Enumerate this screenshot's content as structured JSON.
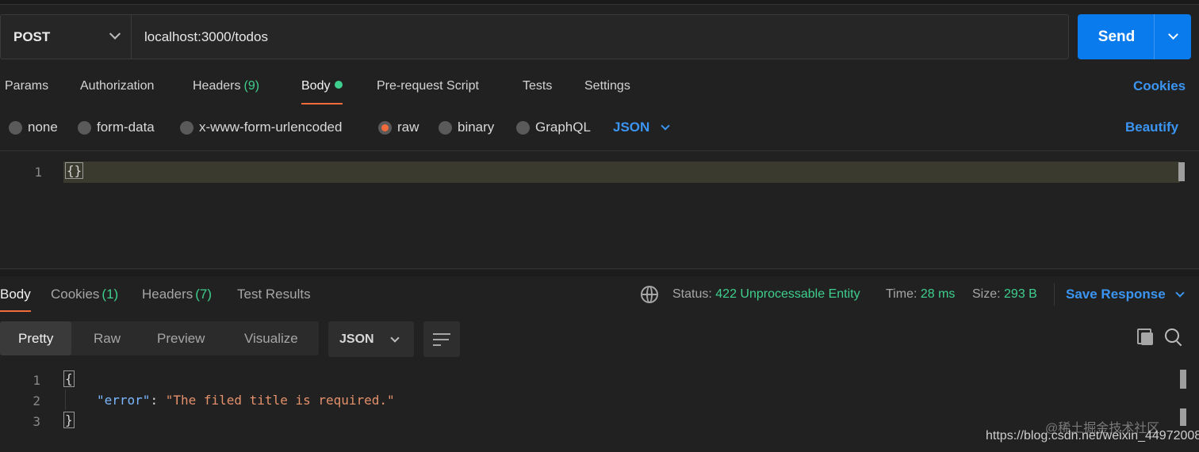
{
  "request": {
    "method": "POST",
    "url": "localhost:3000/todos",
    "send_label": "Send"
  },
  "request_tabs": [
    {
      "label": "Params"
    },
    {
      "label": "Authorization"
    },
    {
      "label": "Headers",
      "count": "(9)"
    },
    {
      "label": "Body",
      "active": true,
      "indicator": "green-dot"
    },
    {
      "label": "Pre-request Script"
    },
    {
      "label": "Tests"
    },
    {
      "label": "Settings"
    }
  ],
  "cookies_link": "Cookies",
  "body_types": [
    {
      "label": "none"
    },
    {
      "label": "form-data"
    },
    {
      "label": "x-www-form-urlencoded"
    },
    {
      "label": "raw",
      "selected": true
    },
    {
      "label": "binary"
    },
    {
      "label": "GraphQL"
    }
  ],
  "raw_language": "JSON",
  "beautify_label": "Beautify",
  "request_editor": {
    "lines": [
      {
        "num": "1",
        "text": "{}"
      }
    ]
  },
  "response_tabs": [
    {
      "label": "Body",
      "active": true
    },
    {
      "label": "Cookies",
      "count": "(1)"
    },
    {
      "label": "Headers",
      "count": "(7)"
    },
    {
      "label": "Test Results"
    }
  ],
  "response_status": {
    "status_label": "Status:",
    "status_value": "422 Unprocessable Entity",
    "time_label": "Time:",
    "time_value": "28 ms",
    "size_label": "Size:",
    "size_value": "293 B"
  },
  "save_response_label": "Save Response",
  "view_modes": [
    {
      "label": "Pretty",
      "active": true
    },
    {
      "label": "Raw"
    },
    {
      "label": "Preview"
    },
    {
      "label": "Visualize"
    }
  ],
  "response_format": "JSON",
  "response_body": {
    "line_numbers": [
      "1",
      "2",
      "3"
    ],
    "open_brace": "{",
    "key": "\"error\"",
    "colon": ": ",
    "value": "\"The filed title is required.\"",
    "close_brace": "}"
  },
  "watermark": {
    "cn": "@稀土掘金技术社区",
    "url": "https://blog.csdn.net/weixin_44972008"
  },
  "colors": {
    "accent_blue": "#097bed",
    "tab_underline": "#f26b3a",
    "success_green": "#3ecf8e",
    "json_key": "#7cb7ff",
    "json_string": "#e4916c"
  }
}
